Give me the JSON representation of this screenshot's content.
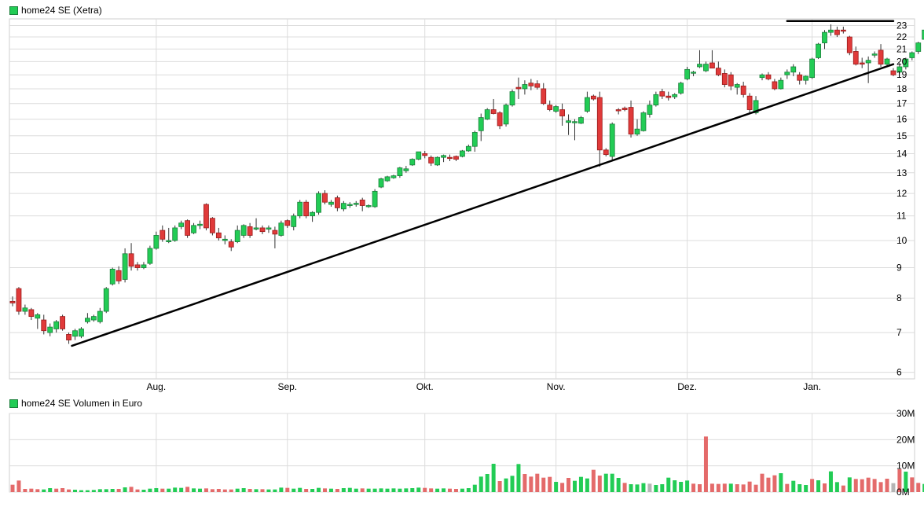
{
  "chart_data": [
    {
      "type": "candlestick",
      "title": "home24 SE (Xetra)",
      "y_scale": "log",
      "ylim": [
        5.85,
        23.6
      ],
      "y_ticks": [
        6,
        7,
        8,
        9,
        10,
        11,
        12,
        13,
        14,
        15,
        16,
        17,
        18,
        19,
        20,
        21,
        22,
        23
      ],
      "x_ticks": [
        {
          "label": "Aug.",
          "index": 23
        },
        {
          "label": "Sep.",
          "index": 44
        },
        {
          "label": "Okt.",
          "index": 66
        },
        {
          "label": "Nov.",
          "index": 87
        },
        {
          "label": "Dez.",
          "index": 108
        },
        {
          "label": "Jan.",
          "index": 128
        }
      ],
      "grid": true,
      "candles": [
        [
          7.9,
          8.05,
          7.75,
          7.85
        ],
        [
          8.3,
          8.35,
          7.5,
          7.6
        ],
        [
          7.6,
          7.8,
          7.5,
          7.7
        ],
        [
          7.65,
          7.7,
          7.35,
          7.45
        ],
        [
          7.4,
          7.55,
          7.1,
          7.5
        ],
        [
          7.35,
          7.5,
          6.95,
          7.05
        ],
        [
          7.0,
          7.25,
          6.9,
          7.15
        ],
        [
          7.1,
          7.35,
          7.0,
          7.3
        ],
        [
          7.45,
          7.5,
          7.05,
          7.1
        ],
        [
          6.95,
          7.0,
          6.7,
          6.8
        ],
        [
          6.9,
          7.1,
          6.8,
          7.05
        ],
        [
          6.9,
          7.15,
          6.85,
          7.1
        ],
        [
          7.3,
          7.55,
          7.25,
          7.4
        ],
        [
          7.35,
          7.5,
          7.3,
          7.45
        ],
        [
          7.3,
          7.7,
          7.25,
          7.6
        ],
        [
          7.6,
          8.35,
          7.55,
          8.3
        ],
        [
          8.45,
          9.0,
          8.4,
          8.95
        ],
        [
          8.9,
          9.05,
          8.45,
          8.55
        ],
        [
          8.6,
          9.7,
          8.5,
          9.5
        ],
        [
          9.5,
          9.9,
          8.9,
          9.05
        ],
        [
          9.1,
          9.2,
          8.9,
          9.0
        ],
        [
          9.0,
          9.2,
          8.95,
          9.1
        ],
        [
          9.15,
          9.8,
          9.1,
          9.7
        ],
        [
          9.7,
          10.35,
          9.65,
          10.2
        ],
        [
          10.4,
          10.6,
          9.95,
          10.05
        ],
        [
          9.95,
          10.5,
          9.9,
          10.0
        ],
        [
          10.0,
          10.6,
          9.95,
          10.5
        ],
        [
          10.55,
          10.8,
          10.45,
          10.7
        ],
        [
          10.8,
          10.85,
          10.1,
          10.2
        ],
        [
          10.3,
          10.7,
          10.25,
          10.6
        ],
        [
          10.6,
          10.8,
          10.45,
          10.65
        ],
        [
          11.5,
          11.55,
          10.4,
          10.5
        ],
        [
          10.9,
          10.95,
          10.2,
          10.3
        ],
        [
          10.3,
          10.5,
          10.0,
          10.1
        ],
        [
          10.0,
          10.2,
          9.85,
          10.05
        ],
        [
          9.95,
          10.05,
          9.6,
          9.75
        ],
        [
          9.95,
          10.6,
          9.9,
          10.4
        ],
        [
          10.2,
          10.65,
          10.1,
          10.6
        ],
        [
          10.55,
          10.7,
          10.1,
          10.2
        ],
        [
          10.45,
          10.9,
          10.4,
          10.5
        ],
        [
          10.5,
          10.6,
          10.25,
          10.35
        ],
        [
          10.45,
          10.6,
          10.3,
          10.5
        ],
        [
          10.4,
          10.55,
          9.7,
          10.25
        ],
        [
          10.2,
          10.8,
          10.15,
          10.7
        ],
        [
          10.8,
          10.85,
          10.5,
          10.6
        ],
        [
          10.55,
          11.1,
          10.4,
          11.0
        ],
        [
          11.0,
          11.7,
          10.9,
          11.6
        ],
        [
          11.6,
          11.7,
          10.9,
          11.0
        ],
        [
          11.0,
          11.2,
          10.75,
          11.15
        ],
        [
          11.15,
          12.1,
          11.05,
          12.0
        ],
        [
          12.0,
          12.15,
          11.5,
          11.6
        ],
        [
          11.5,
          11.7,
          11.4,
          11.6
        ],
        [
          11.8,
          11.9,
          11.2,
          11.35
        ],
        [
          11.3,
          11.65,
          11.2,
          11.55
        ],
        [
          11.45,
          11.6,
          11.35,
          11.5
        ],
        [
          11.5,
          11.65,
          11.4,
          11.55
        ],
        [
          11.7,
          11.8,
          11.2,
          11.45
        ],
        [
          11.45,
          11.5,
          11.35,
          11.45
        ],
        [
          11.4,
          12.2,
          11.35,
          12.1
        ],
        [
          12.3,
          12.75,
          12.25,
          12.7
        ],
        [
          12.6,
          12.85,
          12.55,
          12.8
        ],
        [
          12.75,
          12.9,
          12.7,
          12.85
        ],
        [
          12.85,
          13.3,
          12.75,
          13.25
        ],
        [
          13.1,
          13.35,
          13.0,
          13.2
        ],
        [
          13.4,
          13.75,
          13.35,
          13.7
        ],
        [
          13.7,
          14.1,
          13.65,
          14.1
        ],
        [
          14.0,
          14.15,
          13.75,
          13.9
        ],
        [
          13.8,
          13.9,
          13.35,
          13.5
        ],
        [
          13.4,
          13.85,
          13.35,
          13.8
        ],
        [
          13.8,
          13.95,
          13.55,
          13.9
        ],
        [
          13.8,
          13.95,
          13.6,
          13.75
        ],
        [
          13.85,
          13.9,
          13.6,
          13.7
        ],
        [
          13.85,
          14.2,
          13.8,
          14.15
        ],
        [
          14.15,
          14.5,
          14.1,
          14.4
        ],
        [
          14.4,
          15.3,
          14.1,
          15.2
        ],
        [
          15.3,
          16.35,
          14.7,
          16.1
        ],
        [
          16.0,
          16.7,
          15.95,
          16.6
        ],
        [
          16.6,
          17.3,
          16.3,
          16.35
        ],
        [
          16.4,
          16.5,
          15.4,
          15.6
        ],
        [
          15.7,
          17.0,
          15.55,
          16.9
        ],
        [
          16.9,
          17.95,
          16.8,
          17.8
        ],
        [
          18.1,
          18.8,
          17.3,
          18.0
        ],
        [
          18.0,
          18.6,
          17.6,
          18.3
        ],
        [
          18.4,
          18.7,
          17.9,
          18.2
        ],
        [
          18.35,
          18.6,
          17.95,
          18.1
        ],
        [
          18.0,
          18.4,
          16.9,
          17.0
        ],
        [
          16.9,
          17.2,
          16.5,
          16.6
        ],
        [
          16.5,
          16.9,
          16.4,
          16.8
        ],
        [
          16.6,
          17.0,
          15.6,
          16.2
        ],
        [
          15.8,
          16.3,
          15.05,
          15.9
        ],
        [
          15.8,
          16.0,
          14.75,
          15.85
        ],
        [
          15.75,
          16.2,
          15.7,
          16.1
        ],
        [
          16.5,
          17.8,
          16.4,
          17.4
        ],
        [
          17.5,
          17.6,
          17.2,
          17.3
        ],
        [
          17.4,
          17.8,
          13.3,
          14.2
        ],
        [
          14.2,
          14.3,
          13.85,
          13.95
        ],
        [
          13.85,
          15.8,
          13.6,
          15.7
        ],
        [
          16.6,
          16.7,
          16.3,
          16.55
        ],
        [
          16.7,
          16.8,
          16.5,
          16.6
        ],
        [
          16.75,
          17.2,
          14.9,
          15.1
        ],
        [
          15.1,
          16.0,
          15.0,
          15.4
        ],
        [
          15.3,
          16.5,
          15.25,
          16.4
        ],
        [
          16.3,
          17.2,
          16.1,
          16.9
        ],
        [
          16.9,
          17.8,
          16.8,
          17.6
        ],
        [
          17.8,
          18.0,
          17.3,
          17.5
        ],
        [
          17.5,
          17.8,
          17.2,
          17.4
        ],
        [
          17.45,
          17.7,
          17.3,
          17.6
        ],
        [
          17.7,
          18.5,
          17.6,
          18.4
        ],
        [
          18.7,
          19.6,
          18.6,
          19.4
        ],
        [
          19.2,
          19.3,
          18.9,
          19.2
        ],
        [
          19.6,
          20.9,
          19.5,
          19.8
        ],
        [
          19.3,
          20.0,
          19.2,
          19.8
        ],
        [
          19.9,
          20.9,
          19.7,
          19.5
        ],
        [
          19.5,
          20.0,
          18.9,
          19.0
        ],
        [
          19.1,
          19.4,
          18.1,
          18.3
        ],
        [
          19.0,
          19.2,
          17.9,
          18.2
        ],
        [
          18.1,
          18.4,
          17.6,
          18.3
        ],
        [
          18.2,
          18.5,
          17.4,
          17.6
        ],
        [
          17.5,
          17.7,
          16.4,
          16.6
        ],
        [
          16.4,
          17.5,
          16.3,
          17.2
        ],
        [
          18.8,
          19.1,
          18.6,
          19.0
        ],
        [
          19.0,
          19.2,
          18.6,
          18.7
        ],
        [
          18.5,
          18.7,
          17.9,
          18.0
        ],
        [
          18.0,
          18.8,
          17.95,
          18.6
        ],
        [
          19.0,
          19.4,
          18.7,
          19.2
        ],
        [
          19.2,
          19.8,
          18.9,
          19.6
        ],
        [
          19.0,
          19.2,
          18.3,
          18.6
        ],
        [
          18.6,
          18.95,
          18.3,
          18.9
        ],
        [
          18.8,
          20.3,
          18.7,
          20.2
        ],
        [
          20.3,
          21.5,
          20.2,
          21.4
        ],
        [
          21.5,
          22.6,
          21.0,
          22.4
        ],
        [
          22.4,
          23.1,
          22.1,
          22.6
        ],
        [
          22.6,
          22.9,
          22.0,
          22.2
        ],
        [
          22.6,
          22.9,
          22.3,
          22.5
        ],
        [
          22.0,
          22.1,
          20.5,
          20.7
        ],
        [
          20.8,
          21.2,
          19.7,
          19.8
        ],
        [
          19.9,
          20.3,
          19.5,
          19.8
        ],
        [
          19.9,
          20.4,
          18.4,
          20.1
        ],
        [
          20.5,
          20.8,
          20.3,
          20.6
        ],
        [
          20.9,
          21.4,
          19.6,
          19.8
        ],
        [
          19.8,
          20.3,
          19.6,
          20.2
        ],
        [
          19.3,
          19.5,
          18.9,
          19.0
        ],
        [
          19.2,
          19.9,
          19.1,
          19.6
        ],
        [
          19.6,
          20.3,
          19.4,
          20.2
        ],
        [
          20.3,
          20.8,
          20.1,
          20.7
        ],
        [
          20.8,
          21.6,
          20.6,
          21.5
        ],
        [
          21.8,
          23.0,
          21.7,
          22.6
        ]
      ],
      "trendlines": [
        {
          "from": [
            9.5,
            6.65
          ],
          "to": [
            141.0,
            19.8
          ]
        },
        {
          "from": [
            124.0,
            23.4
          ],
          "to": [
            141.0,
            23.4
          ]
        }
      ]
    },
    {
      "type": "bar",
      "title": "home24 SE Volumen in Euro",
      "ylim": [
        0,
        30000000
      ],
      "y_ticks": [
        {
          "label": "0M",
          "value": 0
        },
        {
          "label": "10M",
          "value": 10000000
        },
        {
          "label": "20M",
          "value": 20000000
        },
        {
          "label": "30M",
          "value": 30000000
        }
      ],
      "grid": true,
      "values": [
        2.8,
        4.4,
        1.2,
        1.3,
        1.1,
        1.0,
        1.5,
        1.3,
        1.5,
        1.0,
        0.9,
        0.7,
        0.7,
        0.8,
        1.1,
        1.1,
        1.2,
        1.2,
        1.8,
        2.0,
        1.0,
        0.9,
        1.3,
        1.5,
        1.3,
        1.3,
        1.7,
        1.6,
        2.0,
        1.4,
        1.3,
        1.4,
        1.1,
        1.2,
        1.0,
        1.0,
        1.3,
        1.5,
        1.2,
        1.1,
        1.1,
        1.0,
        1.0,
        1.7,
        1.6,
        1.3,
        1.6,
        1.2,
        1.2,
        1.6,
        1.4,
        1.3,
        1.2,
        1.5,
        1.6,
        1.3,
        1.4,
        1.3,
        1.3,
        1.4,
        1.3,
        1.4,
        1.3,
        1.4,
        1.5,
        1.7,
        1.6,
        1.4,
        1.3,
        1.4,
        1.3,
        1.2,
        1.3,
        1.5,
        2.8,
        5.9,
        6.9,
        10.8,
        4.2,
        5.2,
        6.2,
        10.7,
        6.9,
        5.9,
        7.0,
        5.5,
        5.8,
        3.9,
        3.5,
        5.4,
        4.3,
        5.8,
        5.2,
        8.5,
        6.3,
        7.0,
        7.0,
        5.4,
        3.5,
        3.0,
        2.9,
        3.4,
        3.2,
        2.7,
        3.0,
        5.5,
        4.5,
        3.9,
        4.4,
        3.2,
        3.0,
        21.2,
        3.2,
        3.1,
        3.2,
        3.2,
        3.0,
        2.9,
        4.0,
        2.8,
        7.0,
        5.5,
        6.4,
        7.2,
        3.1,
        4.3,
        3.0,
        2.7,
        5.0,
        4.5,
        3.3,
        7.9,
        3.8,
        2.5,
        5.6,
        5.0,
        4.9,
        5.5,
        5.0,
        3.8,
        5.1,
        3.4,
        8.7,
        7.8,
        5.6,
        3.5,
        3.1,
        2.9,
        3.5,
        4.9,
        6.0
      ],
      "colors": [
        "r",
        "r",
        "r",
        "r",
        "r",
        "g",
        "g",
        "r",
        "r",
        "r",
        "g",
        "g",
        "g",
        "g",
        "g",
        "g",
        "g",
        "r",
        "g",
        "r",
        "r",
        "g",
        "g",
        "g",
        "r",
        "g",
        "g",
        "g",
        "r",
        "g",
        "g",
        "r",
        "r",
        "r",
        "r",
        "r",
        "g",
        "g",
        "r",
        "g",
        "r",
        "g",
        "g",
        "g",
        "r",
        "g",
        "g",
        "r",
        "g",
        "g",
        "r",
        "g",
        "r",
        "g",
        "g",
        "g",
        "r",
        "g",
        "g",
        "g",
        "g",
        "g",
        "g",
        "g",
        "g",
        "g",
        "r",
        "r",
        "g",
        "g",
        "r",
        "r",
        "g",
        "g",
        "g",
        "g",
        "g",
        "g",
        "r",
        "g",
        "g",
        "g",
        "r",
        "r",
        "r",
        "r",
        "r",
        "g",
        "r",
        "r",
        "g",
        "g",
        "g",
        "r",
        "r",
        "g",
        "g",
        "g",
        "r",
        "g",
        "g",
        "g",
        "x",
        "g",
        "g",
        "g",
        "g",
        "g",
        "g",
        "r",
        "r",
        "r",
        "r",
        "r",
        "r",
        "g",
        "r",
        "r",
        "r",
        "r",
        "r",
        "r",
        "r",
        "g",
        "r",
        "g",
        "g",
        "g",
        "r",
        "g",
        "r",
        "g",
        "g",
        "r",
        "g",
        "r",
        "r",
        "r",
        "r",
        "r",
        "r",
        "x",
        "r",
        "g",
        "r",
        "r",
        "g",
        "g",
        "g",
        "g",
        "g"
      ]
    }
  ],
  "colors": {
    "up_fill": "#22cc55",
    "up_stroke": "#1a7f3a",
    "down_fill": "#e03a3a",
    "down_stroke": "#9a1a1a",
    "vol_up": "#22cc55",
    "vol_down": "#e46a6a",
    "vol_neutral": "#b5b5b5",
    "grid": "#dcdcdc",
    "frame": "#cfcfcf",
    "wick": "#333333",
    "trendline": "#000000"
  }
}
